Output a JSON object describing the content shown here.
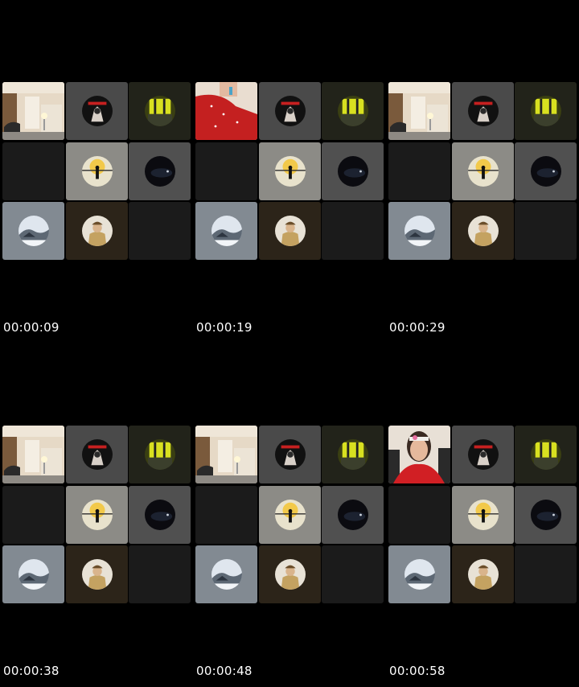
{
  "frames": [
    {
      "timestamp": "00:00:09",
      "cam_state": "room"
    },
    {
      "timestamp": "00:00:19",
      "cam_state": "person-closeup"
    },
    {
      "timestamp": "00:00:29",
      "cam_state": "room"
    },
    {
      "timestamp": "00:00:38",
      "cam_state": "room"
    },
    {
      "timestamp": "00:00:48",
      "cam_state": "room"
    },
    {
      "timestamp": "00:00:58",
      "cam_state": "person-headband"
    }
  ],
  "tiles": [
    {
      "kind": "camera"
    },
    {
      "kind": "avatar",
      "avatar": "dark-poster-avatar",
      "bg": "#4a4a4a"
    },
    {
      "kind": "avatar",
      "avatar": "yellow-window-avatar",
      "bg": "#22231a"
    },
    {
      "kind": "empty",
      "bg": "#1b1b1b"
    },
    {
      "kind": "avatar",
      "avatar": "sunset-silhouette-avatar",
      "bg": "#8c8b86"
    },
    {
      "kind": "avatar",
      "avatar": "night-scene-avatar",
      "bg": "#505050"
    },
    {
      "kind": "avatar",
      "avatar": "snow-scene-avatar",
      "bg": "#828a92"
    },
    {
      "kind": "avatar",
      "avatar": "person-hat-avatar",
      "bg": "#2c2419"
    },
    {
      "kind": "empty",
      "bg": "#1b1b1b"
    }
  ],
  "colors": {
    "background": "#000000",
    "timestamp_text": "#ffffff"
  }
}
